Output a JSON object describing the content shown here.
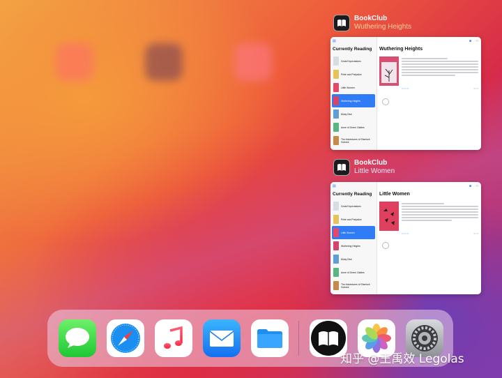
{
  "switcher": {
    "windows": [
      {
        "app_name": "BookClub",
        "window_title": "Wuthering Heights",
        "sidebar_title": "Currently Reading",
        "detail_title": "Wuthering Heights",
        "selected_index": 3
      },
      {
        "app_name": "BookClub",
        "window_title": "Little Women",
        "sidebar_title": "Currently Reading",
        "detail_title": "Little Women",
        "selected_index": 2
      }
    ]
  },
  "books": [
    {
      "title": "Great Expectations",
      "cover_color": "#d9dde3"
    },
    {
      "title": "Pride and Prejudice",
      "cover_color": "#e6c35a"
    },
    {
      "title": "Little Women",
      "cover_color": "#e24a6b"
    },
    {
      "title": "Wuthering Heights",
      "cover_color": "#d1466a"
    },
    {
      "title": "Moby Dick",
      "cover_color": "#5e9ed3"
    },
    {
      "title": "Anne of Green Gables",
      "cover_color": "#57b784"
    },
    {
      "title": "The Adventures of Sherlock Holmes",
      "cover_color": "#c58b4a"
    }
  ],
  "dock": {
    "apps": [
      {
        "name": "Messages",
        "icon": "messages-icon"
      },
      {
        "name": "Safari",
        "icon": "safari-icon"
      },
      {
        "name": "Music",
        "icon": "music-icon"
      },
      {
        "name": "Mail",
        "icon": "mail-icon"
      },
      {
        "name": "Files",
        "icon": "files-icon"
      },
      {
        "name": "BookClub",
        "icon": "book-icon"
      },
      {
        "name": "Photos",
        "icon": "photos-icon"
      },
      {
        "name": "Settings",
        "icon": "settings-gear-icon"
      }
    ]
  },
  "watermark": "知乎 @王禹效 Legolas"
}
